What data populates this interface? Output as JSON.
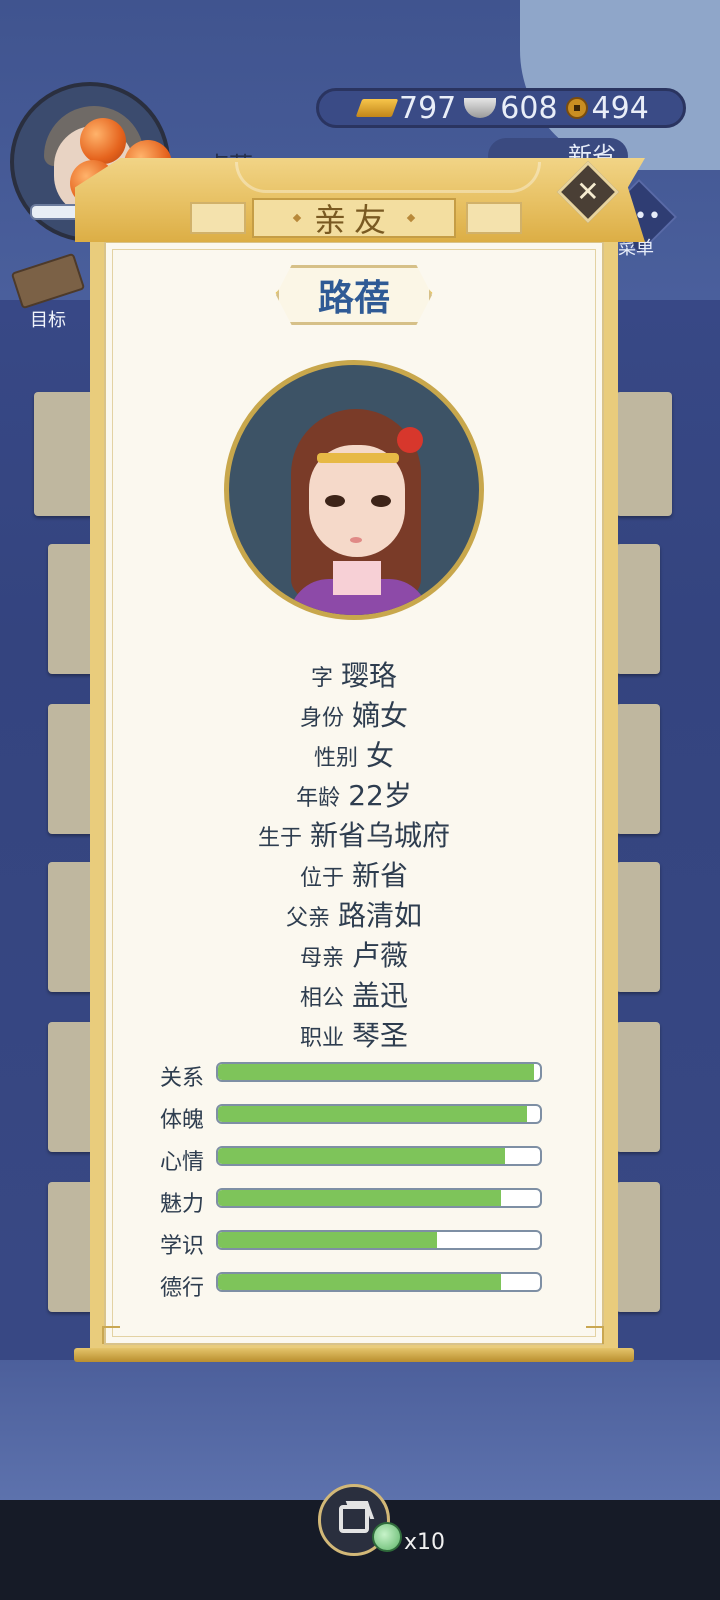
{
  "hud": {
    "player_name": "卢薇",
    "goal_label": "目标",
    "resources": [
      {
        "icon": "gold-ingot-icon",
        "value": "797"
      },
      {
        "icon": "silver-ingot-icon",
        "value": "608"
      },
      {
        "icon": "copper-coin-icon",
        "value": "494"
      }
    ],
    "location_label": "新省",
    "menu_label": "菜单"
  },
  "dialog": {
    "title": "亲友",
    "close_icon": "close-icon",
    "name": "路蓓",
    "portrait_icon": "character-portrait",
    "info": [
      {
        "key": "字",
        "value": "璎珞"
      },
      {
        "key": "身份",
        "value": "嫡女"
      },
      {
        "key": "性别",
        "value": "女"
      },
      {
        "key": "年龄",
        "value": "22岁"
      },
      {
        "key": "生于",
        "value": "新省乌城府"
      },
      {
        "key": "位于",
        "value": "新省"
      },
      {
        "key": "父亲",
        "value": "路清如"
      },
      {
        "key": "母亲",
        "value": "卢薇"
      },
      {
        "key": "相公",
        "value": "盖迅"
      },
      {
        "key": "职业",
        "value": "琴圣"
      }
    ],
    "stats": [
      {
        "label": "关系",
        "fraction": 0.98
      },
      {
        "label": "体魄",
        "fraction": 0.96
      },
      {
        "label": "心情",
        "fraction": 0.89
      },
      {
        "label": "魅力",
        "fraction": 0.88
      },
      {
        "label": "学识",
        "fraction": 0.68
      },
      {
        "label": "德行",
        "fraction": 0.88
      }
    ]
  },
  "bottom": {
    "share_icon": "share-icon",
    "jade_icon": "jade-token-icon",
    "share_count": "x10"
  },
  "colors": {
    "bar_fill": "#7ec45a",
    "panel_gold": "#e9cc7c",
    "name_blue": "#2f5a95"
  }
}
